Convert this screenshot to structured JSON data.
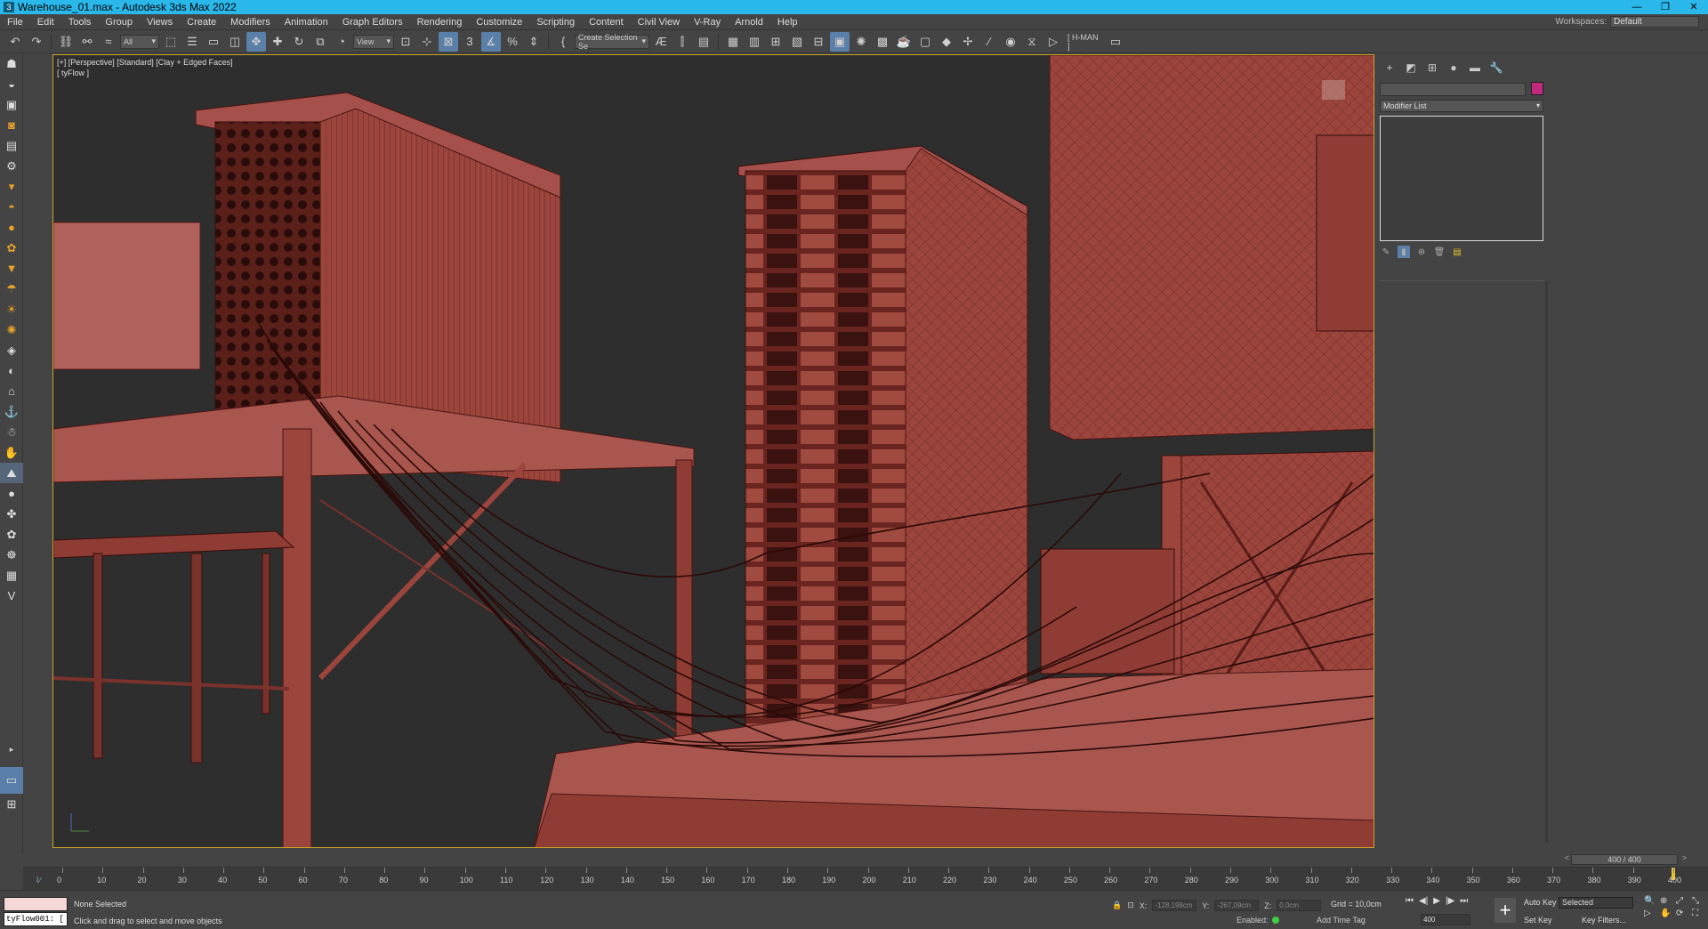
{
  "window": {
    "title": "Warehouse_01.max - Autodesk 3ds Max 2022",
    "app_icon": "3",
    "buttons": [
      "—",
      "❐",
      "✕"
    ]
  },
  "menu": {
    "items": [
      "File",
      "Edit",
      "Tools",
      "Group",
      "Views",
      "Create",
      "Modifiers",
      "Animation",
      "Graph Editors",
      "Rendering",
      "Customize",
      "Scripting",
      "Content",
      "Civil View",
      "V-Ray",
      "Arnold",
      "Help"
    ],
    "workspaces_label": "Workspaces:",
    "workspaces_value": "Default"
  },
  "toolbar": {
    "filter_value": "All",
    "refcoord_value": "View",
    "selection_set_value": "Create Selection Se",
    "hman_label": "[ H-MAN ]",
    "icons": [
      "undo-icon",
      "redo-icon",
      "link-icon",
      "unlink-icon",
      "bind-spacewarp-icon",
      "select-object-icon",
      "select-by-name-icon",
      "rect-region-icon",
      "window-crossing-icon",
      "select-move-icon",
      "select-rotate-icon",
      "select-scale-icon",
      "place-icon",
      "pivot-icon",
      "select-manipulate-icon",
      "keyboard-shortcut-icon",
      "snaps-toggle-icon",
      "angle-snap-icon",
      "percent-snap-icon",
      "spinner-snap-icon",
      "edit-named-sets-icon",
      "mirror-icon",
      "align-icon",
      "layer-explorer-icon",
      "toggle-ribbon-icon",
      "curve-editor-icon",
      "schematic-view-icon",
      "material-editor-icon",
      "render-setup-icon",
      "rendered-frame-icon",
      "render-icon"
    ]
  },
  "left_toolbar": {
    "icons": [
      "teapot-icon",
      "sphere-icon",
      "camera-icon",
      "shape-icon",
      "box-icon",
      "light-icon",
      "cone-icon",
      "torus-icon",
      "geosphere-icon",
      "omni-light-icon",
      "spot-light-icon",
      "sun-icon",
      "sky-icon",
      "box-modifier-icon",
      "sphere-modifier-icon",
      "helper-icon",
      "spacewarp-icon",
      "system-icon",
      "dynamics-icon",
      "particles-icon",
      "grass-icon",
      "globe-icon",
      "scatter-icon",
      "bolt-icon",
      "chain-icon",
      "layers-icon",
      "vray-icon"
    ]
  },
  "viewport": {
    "label": "[+] [Perspective] [Standard] [Clay + Edged Faces]",
    "sublabel": "[ tyFlow ]",
    "scene_color": "#9b453d",
    "background": "#2e2e2e"
  },
  "command_panel": {
    "tabs": [
      "create-tab-icon",
      "modify-tab-icon",
      "hierarchy-tab-icon",
      "motion-tab-icon",
      "display-tab-icon",
      "utilities-tab-icon"
    ],
    "tab_glyphs": [
      "+",
      "◩",
      "⊞",
      "●",
      "▬",
      "🔧"
    ],
    "modifier_list": "Modifier List",
    "object_color": "#c2287e"
  },
  "timeline": {
    "slider_value": "400 / 400",
    "ticks": [
      0,
      10,
      20,
      30,
      40,
      50,
      60,
      70,
      80,
      90,
      100,
      110,
      120,
      130,
      140,
      150,
      160,
      170,
      180,
      190,
      200,
      210,
      220,
      230,
      240,
      250,
      260,
      270,
      280,
      290,
      300,
      310,
      320,
      330,
      340,
      350,
      360,
      370,
      380,
      390,
      400
    ],
    "current_frame": 400
  },
  "status": {
    "maxscript_output": "",
    "maxscript_input": "tyFlow001: [",
    "selection": "None Selected",
    "prompt": "Click and drag to select and move objects",
    "x_label": "X:",
    "x_value": "-128,198cm",
    "y_label": "Y:",
    "y_value": "-267,09cm",
    "z_label": "Z:",
    "z_value": "0,0cm",
    "grid": "Grid = 10,0cm",
    "enabled_label": "Enabled:",
    "add_time_tag": "Add Time Tag",
    "frame_input": "400",
    "auto_key": "Auto Key",
    "set_key": "Set Key",
    "key_mode": "Selected",
    "key_filters": "Key Filters..."
  }
}
